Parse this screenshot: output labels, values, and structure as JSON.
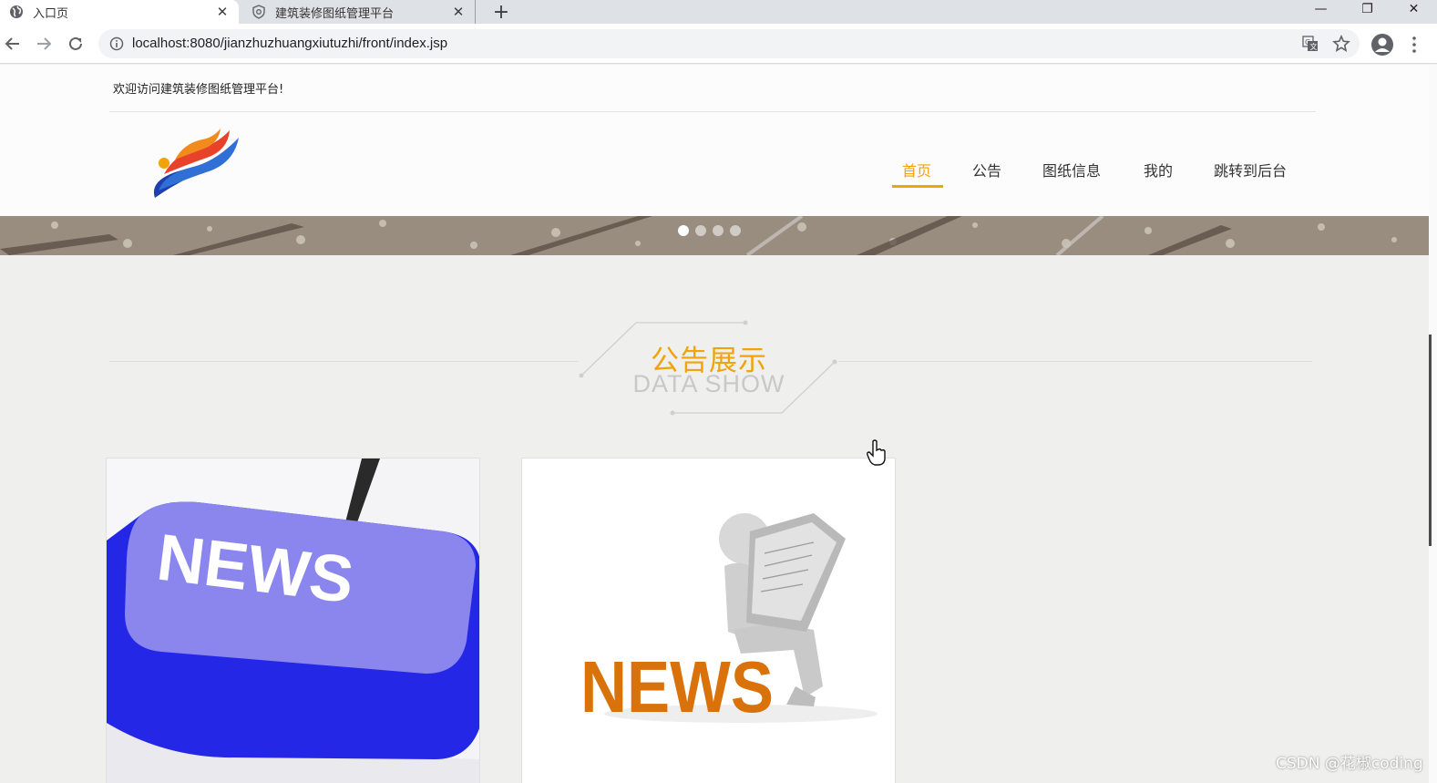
{
  "browser": {
    "tabs": [
      {
        "title": "入口页",
        "icon": "globe-icon",
        "active": true
      },
      {
        "title": "建筑装修图纸管理平台",
        "icon": "shield-icon",
        "active": false
      }
    ],
    "new_tab_label": "+",
    "window_controls": {
      "minimize": "—",
      "maximize": "❐",
      "close": "✕"
    },
    "close_glyph": "✕",
    "url": "localhost:8080/jianzhuzhuangxiutuzhi/front/index.jsp"
  },
  "page": {
    "welcome": "欢迎访问建筑装修图纸管理平台!",
    "nav": [
      {
        "label": "首页",
        "active": true
      },
      {
        "label": "公告",
        "active": false
      },
      {
        "label": "图纸信息",
        "active": false
      },
      {
        "label": "我的",
        "active": false
      },
      {
        "label": "跳转到后台",
        "active": false
      }
    ],
    "carousel": {
      "dots": 4,
      "active_index": 0
    },
    "section": {
      "title_cn": "公告展示",
      "title_en": "DATA SHOW"
    },
    "cards": [
      {
        "image_text": "NEWS",
        "image": "news-keyboard-key"
      },
      {
        "image_text": "NEWS",
        "image": "news-reader-figure"
      }
    ]
  },
  "watermark": "CSDN @花椒coding",
  "colors": {
    "accent": "#f0a30a",
    "page_bg": "#efefed",
    "tab_bar": "#dee1e6"
  }
}
